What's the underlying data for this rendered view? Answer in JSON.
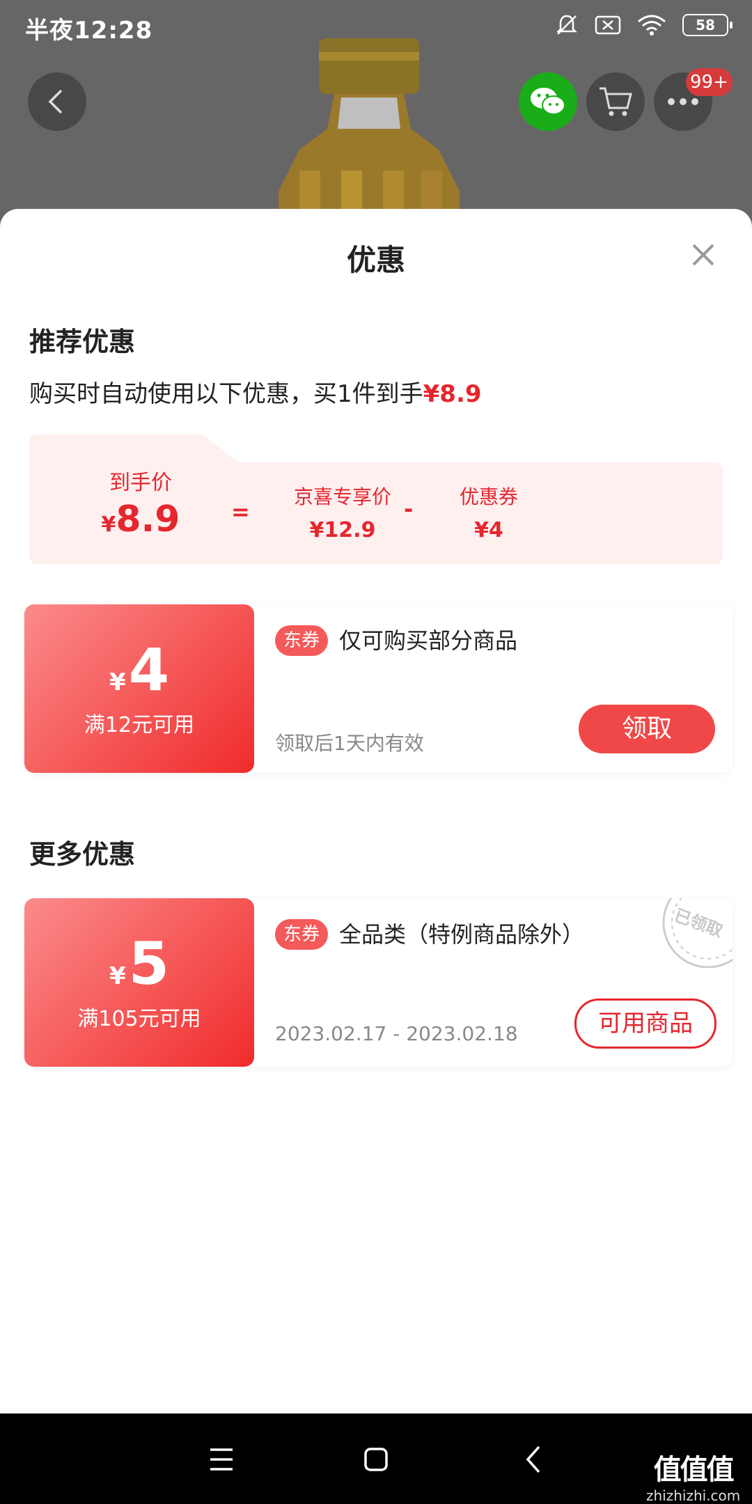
{
  "status_bar": {
    "time": "半夜12:28",
    "battery": "58",
    "icons": [
      "mute-bell-icon",
      "sim-off-icon",
      "wifi-icon",
      "battery-icon"
    ]
  },
  "header": {
    "back_icon": "back-icon",
    "wechat_icon": "wechat-icon",
    "cart_icon": "cart-icon",
    "more_icon": "more-icon",
    "notification_badge": "99+"
  },
  "sheet": {
    "title": "优惠",
    "close_icon": "close-icon",
    "recommended": {
      "heading": "推荐优惠",
      "summary_prefix": "购买时自动使用以下优惠，买1件到手",
      "summary_price": "¥8.9",
      "breakdown": {
        "final_label": "到手价",
        "final_currency": "¥",
        "final_value": "8.9",
        "equals": "=",
        "member_label": "京喜专享价",
        "member_value": "¥12.9",
        "minus": "-",
        "coupon_label": "优惠券",
        "coupon_value": "¥4"
      },
      "coupon": {
        "currency": "¥",
        "amount": "4",
        "condition": "满12元可用",
        "tag": "东券",
        "description": "仅可购买部分商品",
        "validity": "领取后1天内有效",
        "button": "领取"
      }
    },
    "more": {
      "heading": "更多优惠",
      "coupon": {
        "currency": "¥",
        "amount": "5",
        "condition": "满105元可用",
        "tag": "东券",
        "description": "全品类（特例商品除外）",
        "validity": "2023.02.17 - 2023.02.18",
        "button": "可用商品",
        "stamp": "已领取"
      }
    }
  },
  "nav_bar": {
    "menu_icon": "menu-icon",
    "home_icon": "home-icon",
    "back_icon": "nav-back-icon",
    "watermark_logo": "值值值",
    "watermark_url": "zhizhizhi.com"
  },
  "colors": {
    "accent": "#e5262e",
    "coupon_gradient_start": "#fb8b8b",
    "coupon_gradient_end": "#f02b2b",
    "breakdown_bg": "#fff0f0",
    "wechat": "#1aad19"
  }
}
